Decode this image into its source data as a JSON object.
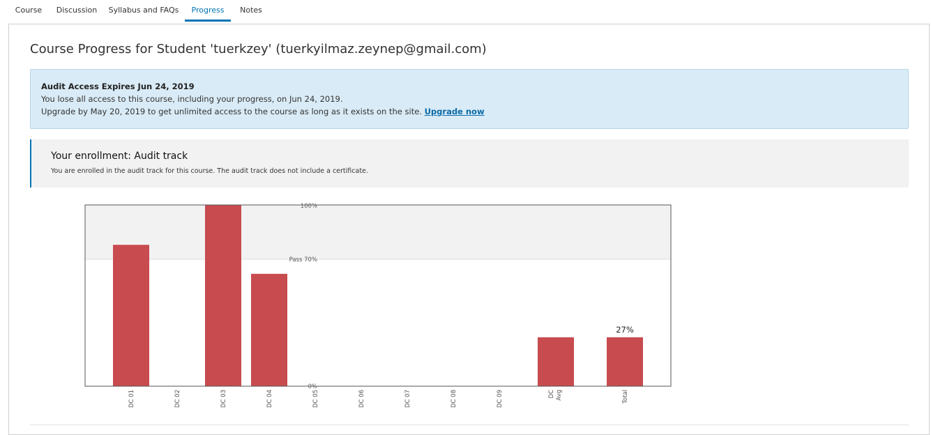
{
  "tabs": [
    {
      "label": "Course",
      "active": false
    },
    {
      "label": "Discussion",
      "active": false
    },
    {
      "label": "Syllabus and FAQs",
      "active": false
    },
    {
      "label": "Progress",
      "active": true
    },
    {
      "label": "Notes",
      "active": false
    }
  ],
  "page": {
    "title": "Course Progress for Student 'tuerkzey' (tuerkyilmaz.zeynep@gmail.com)"
  },
  "alert": {
    "title": "Audit Access Expires Jun 24, 2019",
    "line1": "You lose all access to this course, including your progress, on Jun 24, 2019.",
    "line2": "Upgrade by May 20, 2019 to get unlimited access to the course as long as it exists on the site.",
    "link": "Upgrade now"
  },
  "enrollment": {
    "title": "Your enrollment: Audit track",
    "description": "You are enrolled in the audit track for this course. The audit track does not include a certificate."
  },
  "colors": {
    "accent": "#0075b4",
    "bar": "#c84b4f",
    "alert_bg": "#d9ebf6",
    "pass_band": "#f2f2f2"
  },
  "chart_data": {
    "type": "bar",
    "categories": [
      "DC 01",
      "DC 02",
      "DC 03",
      "DC 04",
      "DC 05",
      "DC 06",
      "DC 07",
      "DC 08",
      "DC 09",
      "DC Avg",
      "Total"
    ],
    "values": [
      78,
      0,
      100,
      62,
      0,
      0,
      0,
      0,
      0,
      27,
      27
    ],
    "ylim": [
      0,
      100
    ],
    "pass_threshold": 70,
    "y_labels": {
      "top": "100%",
      "pass": "Pass 70%",
      "zero": "0%"
    },
    "annotations": [
      {
        "category": "Total",
        "text": "27%"
      }
    ]
  }
}
